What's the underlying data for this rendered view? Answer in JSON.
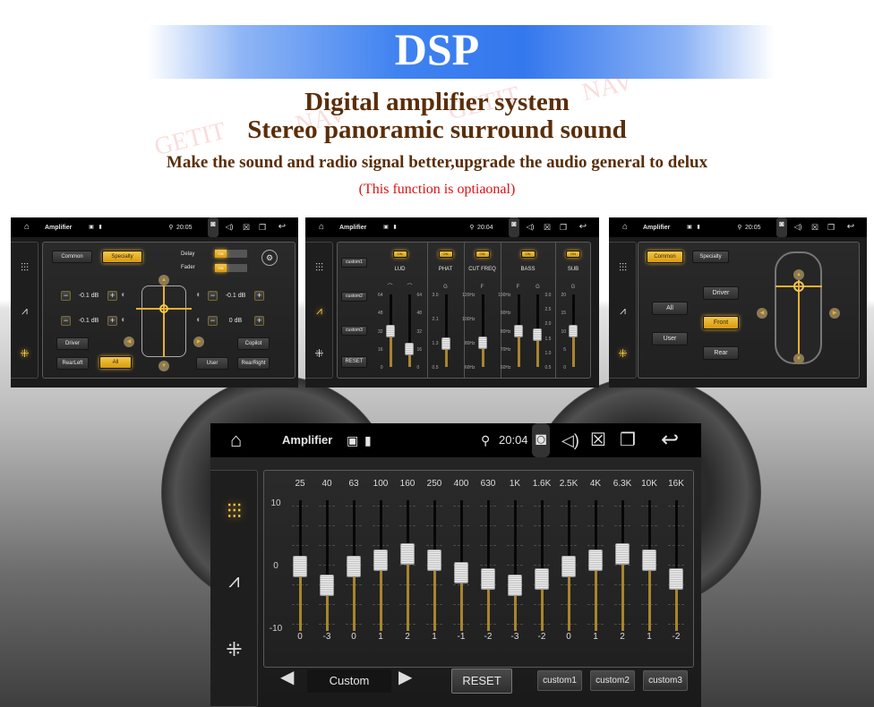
{
  "banner": {
    "title": "DSP",
    "line1": "Digital amplifier system",
    "line2": "Stereo panoramic surround sound",
    "line3": "Make the sound and radio signal better,upgrade the audio general to delux",
    "note": "(This function is optiaonal)",
    "watermark": [
      "GETIT",
      "NAV",
      "GETIT",
      "NAV"
    ],
    "colors": {
      "bar": "#3478ee",
      "heading": "#5a2e0a",
      "note": "#e01010",
      "accent": "#e7b030"
    }
  },
  "screens": {
    "s1": {
      "title": "Amplifier",
      "time": "20:05",
      "tabs": [
        "Common",
        "Specialty"
      ],
      "active_tab": "Specialty",
      "delay_label": "Delay",
      "fader_label": "Fader",
      "toggle_on": "ON",
      "levels": {
        "front_left": "-0.1 dB",
        "rear_left": "-0.1 dB",
        "front_right": "-0.1 dB",
        "rear_right": "0 dB"
      },
      "buttons": {
        "driver": "Driver",
        "rear_left": "RearLeft",
        "all": "All",
        "user": "User",
        "copilot": "Copilot",
        "rear_right": "RearRight"
      },
      "active_button": "All"
    },
    "s2": {
      "title": "Amplifier",
      "time": "20:04",
      "presets": [
        "custom1",
        "custom2",
        "custom3"
      ],
      "reset": "RESET",
      "columns": [
        {
          "name": "LUD",
          "on": "ON",
          "sliders": [
            {
              "label": "⌒",
              "ticks": [
                "64",
                "48",
                "32",
                "16",
                "0"
              ],
              "min": 0,
              "max": 64,
              "value": 32
            },
            {
              "label": "⌒",
              "ticks": [
                "64",
                "48",
                "32",
                "16",
                "0"
              ],
              "min": 0,
              "max": 64,
              "value": 16
            }
          ]
        },
        {
          "name": "PHAT",
          "on": "ON",
          "sliders": [
            {
              "label": "G",
              "ticks": [
                "3.0",
                "2.1",
                "1.3",
                "0.5"
              ],
              "min": 0.5,
              "max": 3.0,
              "value": 1.3
            }
          ]
        },
        {
          "name": "CUT FREQ",
          "on": "ON",
          "sliders": [
            {
              "label": "F",
              "ticks": [
                "120Hz",
                "100Hz",
                "80Hz",
                "60Hz"
              ],
              "min": 60,
              "max": 120,
              "value": 80
            }
          ]
        },
        {
          "name": "BASS",
          "on": "ON",
          "sliders": [
            {
              "label": "F",
              "ticks": [
                "100Hz",
                "90Hz",
                "80Hz",
                "70Hz",
                "60Hz"
              ],
              "min": 60,
              "max": 100,
              "value": 80
            },
            {
              "label": "G",
              "ticks": [
                "3.0",
                "2.5",
                "2.0",
                "1.5",
                "1.0",
                "0.5"
              ],
              "min": 0.5,
              "max": 3.0,
              "value": 1.6
            }
          ]
        },
        {
          "name": "SUB",
          "on": "ON",
          "sliders": [
            {
              "label": "G",
              "ticks": [
                "20",
                "15",
                "10",
                "5",
                "0"
              ],
              "min": 0,
              "max": 20,
              "value": 10
            }
          ]
        }
      ]
    },
    "s3": {
      "title": "Amplifier",
      "time": "20:05",
      "tabs": [
        "Common",
        "Specialty"
      ],
      "active_tab": "Common",
      "buttons": {
        "all": "All",
        "user": "User",
        "driver": "Driver",
        "front": "Front",
        "rear": "Rear"
      },
      "active_button": "Front"
    },
    "main": {
      "title": "Amplifier",
      "time": "20:04",
      "scale": [
        "10",
        "0",
        "-10"
      ],
      "range": [
        -10,
        10
      ],
      "bands": [
        {
          "freq": "25",
          "value": 0
        },
        {
          "freq": "40",
          "value": -3
        },
        {
          "freq": "63",
          "value": 0
        },
        {
          "freq": "100",
          "value": 1
        },
        {
          "freq": "160",
          "value": 2
        },
        {
          "freq": "250",
          "value": 1
        },
        {
          "freq": "400",
          "value": -1
        },
        {
          "freq": "630",
          "value": -2
        },
        {
          "freq": "1K",
          "value": -3
        },
        {
          "freq": "1.6K",
          "value": -2
        },
        {
          "freq": "2.5K",
          "value": 0
        },
        {
          "freq": "4K",
          "value": 1
        },
        {
          "freq": "6.3K",
          "value": 2
        },
        {
          "freq": "10K",
          "value": 1
        },
        {
          "freq": "16K",
          "value": -2
        }
      ],
      "preset": "Custom",
      "reset": "RESET",
      "presets": [
        "custom1",
        "custom2",
        "custom3"
      ],
      "active_sidebar": "equalizer"
    }
  }
}
